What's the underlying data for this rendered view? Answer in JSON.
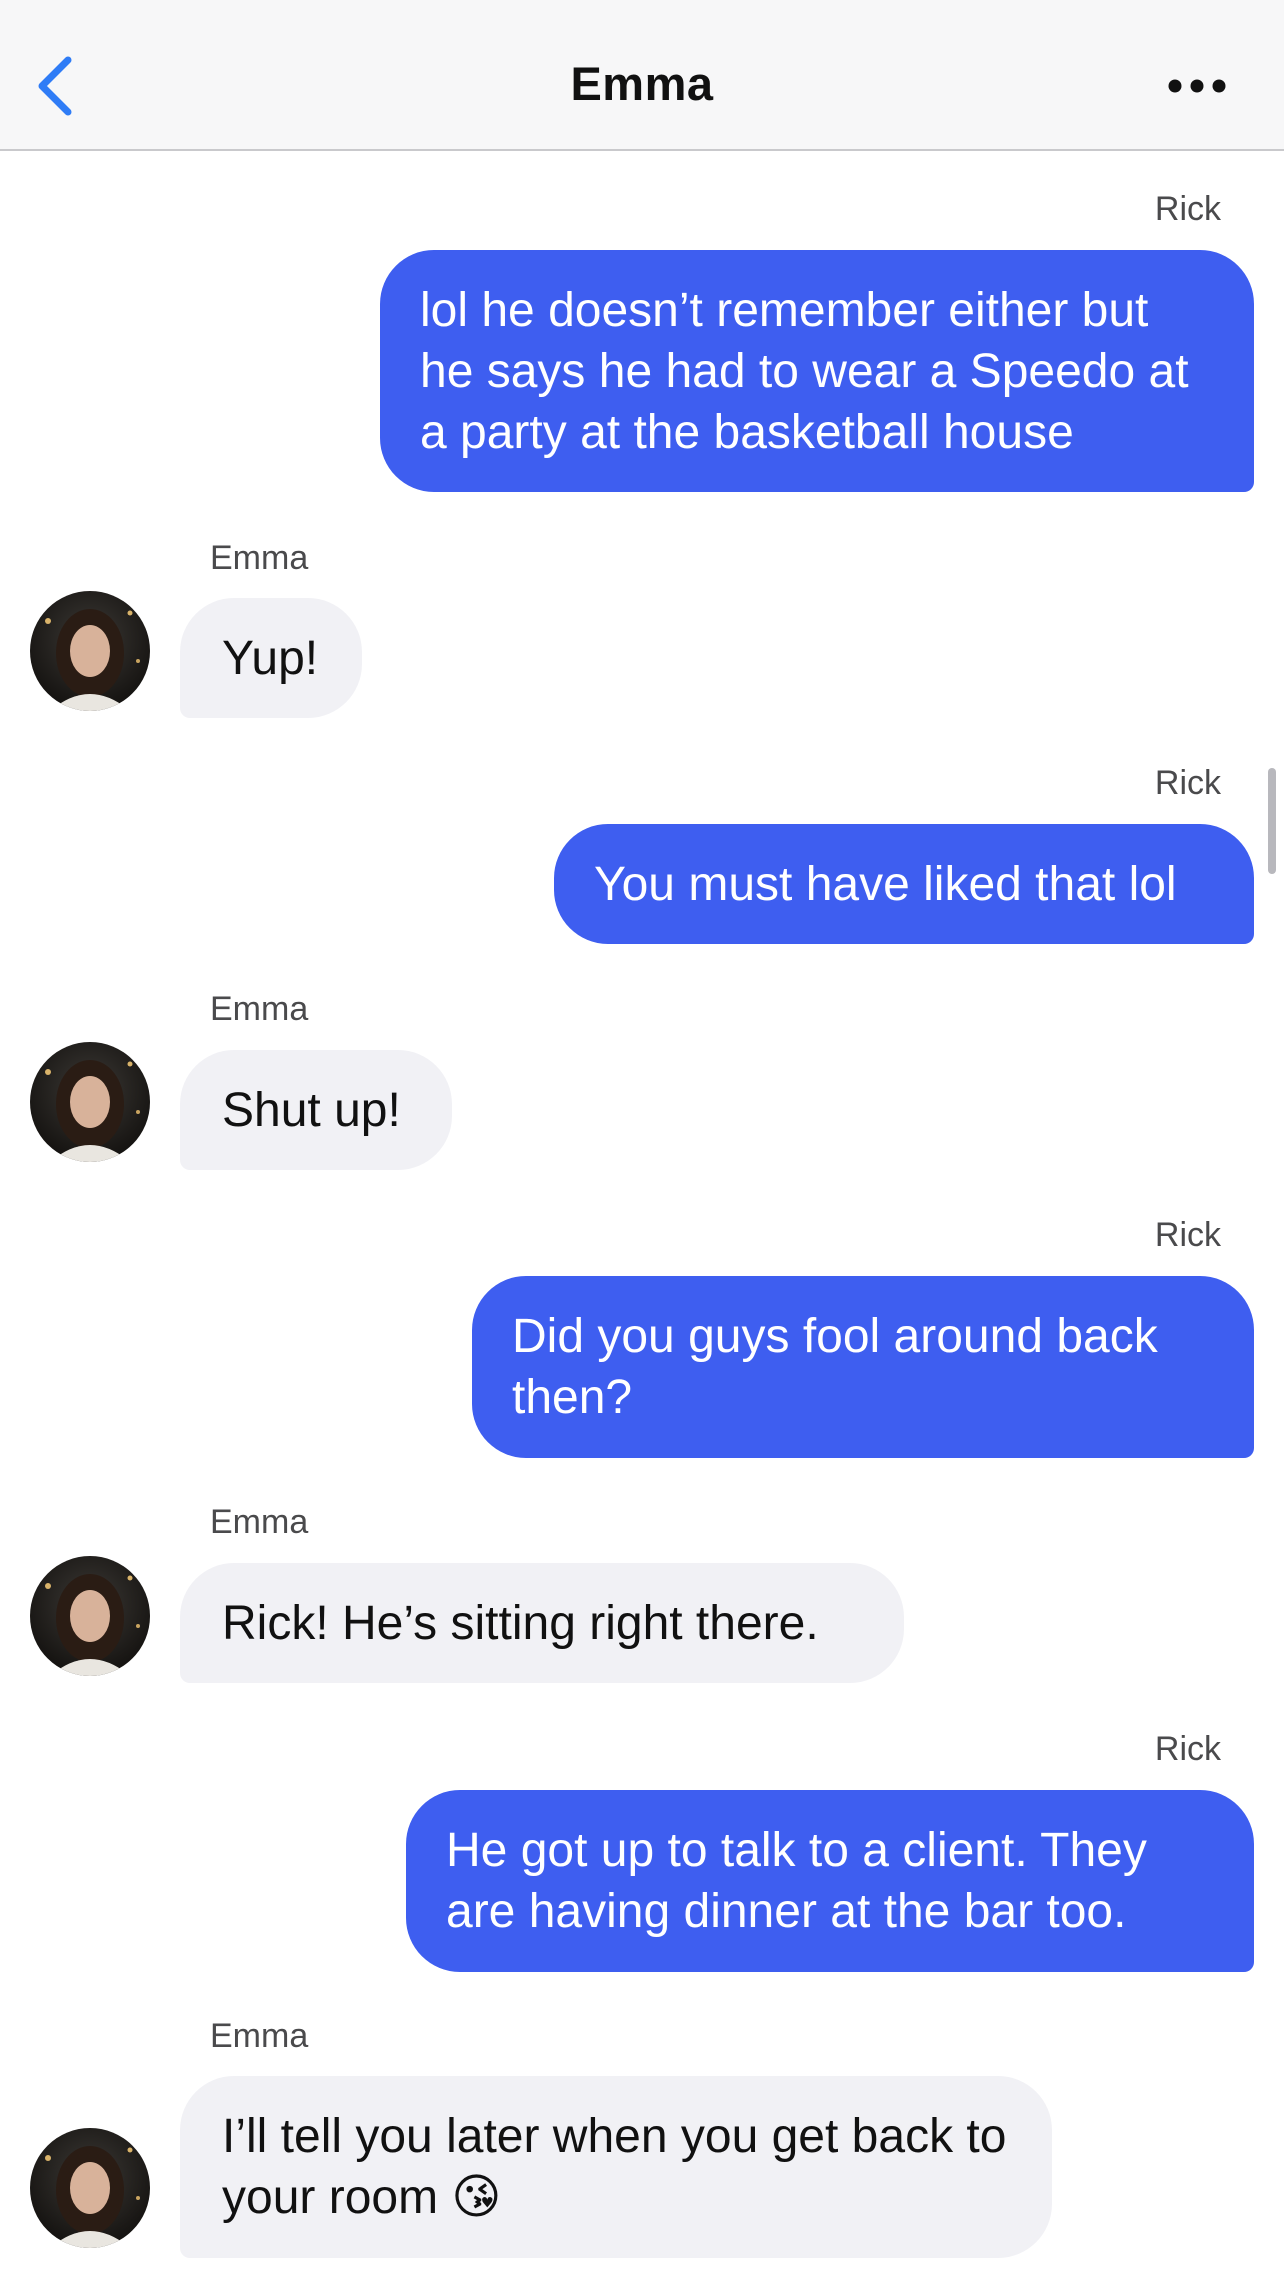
{
  "header": {
    "title": "Emma",
    "back_icon": "chevron-left-icon",
    "more_icon": "ellipsis-icon",
    "accent": "#2f7cf6"
  },
  "colors": {
    "outgoing_bubble": "#3e5ef0",
    "incoming_bubble": "#f1f1f5"
  },
  "messages": [
    {
      "sender": "Rick",
      "direction": "outgoing",
      "text": "lol he doesn’t remember either but he says he had to wear a Speedo at a party at the basketball house"
    },
    {
      "sender": "Emma",
      "direction": "incoming",
      "text": "Yup!"
    },
    {
      "sender": "Rick",
      "direction": "outgoing",
      "text": "You must have liked that lol"
    },
    {
      "sender": "Emma",
      "direction": "incoming",
      "text": "Shut up!"
    },
    {
      "sender": "Rick",
      "direction": "outgoing",
      "text": "Did you guys fool around back then?"
    },
    {
      "sender": "Emma",
      "direction": "incoming",
      "text": "Rick! He’s sitting right there."
    },
    {
      "sender": "Rick",
      "direction": "outgoing",
      "text": "He got up to talk to a client. They are having dinner at the bar too."
    },
    {
      "sender": "Emma",
      "direction": "incoming",
      "text": "I’ll tell you later when you get back to your room 😘"
    }
  ]
}
